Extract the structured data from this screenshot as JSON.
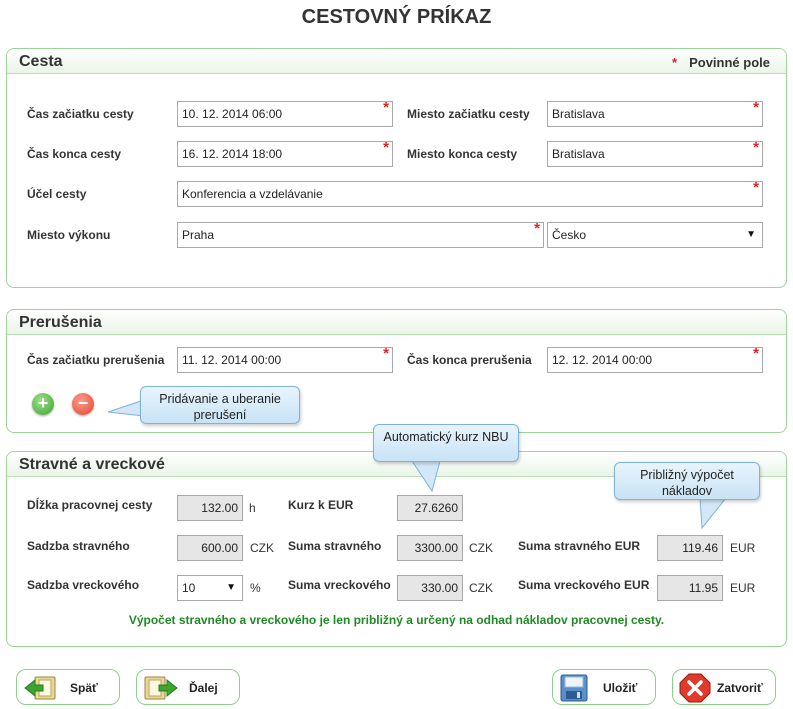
{
  "page": {
    "title": "CESTOVNÝ PRÍKAZ"
  },
  "trip": {
    "title": "Cesta",
    "required_note": "Povinné pole",
    "start_time_label": "Čas začiatku cesty",
    "start_time_value": "10. 12. 2014 06:00",
    "start_place_label": "Miesto začiatku cesty",
    "start_place_value": "Bratislava",
    "end_time_label": "Čas konca cesty",
    "end_time_value": "16. 12. 2014 18:00",
    "end_place_label": "Miesto konca cesty",
    "end_place_value": "Bratislava",
    "purpose_label": "Účel cesty",
    "purpose_value": "Konferencia a vzdelávanie",
    "work_place_label": "Miesto výkonu",
    "work_place_value": "Praha",
    "country_value": "Česko"
  },
  "interruptions": {
    "title": "Prerušenia",
    "start_label": "Čas začiatku prerušenia",
    "start_value": "11. 12. 2014 00:00",
    "end_label": "Čas konca prerušenia",
    "end_value": "12. 12. 2014 00:00",
    "callout": "Pridávanie a uberanie prerušení"
  },
  "allowances": {
    "title": "Stravné a vreckové",
    "length_label": "Dĺžka pracovnej cesty",
    "length_value": "132.00",
    "length_unit": "h",
    "rate_label": "Kurz k EUR",
    "rate_value": "27.6260",
    "meal_rate_label": "Sadzba stravného",
    "meal_rate_value": "600.00",
    "meal_rate_unit": "CZK",
    "meal_sum_label": "Suma stravného",
    "meal_sum_value": "3300.00",
    "meal_sum_unit": "CZK",
    "meal_eur_label": "Suma stravného EUR",
    "meal_eur_value": "119.46",
    "meal_eur_unit": "EUR",
    "pocket_rate_label": "Sadzba vreckového",
    "pocket_rate_value": "10",
    "pocket_rate_unit": "%",
    "pocket_sum_label": "Suma vreckového",
    "pocket_sum_value": "330.00",
    "pocket_sum_unit": "CZK",
    "pocket_eur_label": "Suma vreckového EUR",
    "pocket_eur_value": "11.95",
    "pocket_eur_unit": "EUR",
    "callout_rate": "Automatický kurz NBU",
    "callout_costs": "Približný výpočet nákladov",
    "note": "Výpočet stravného a vreckového je len približný a určený na odhad nákladov pracovnej cesty."
  },
  "actions": {
    "back": "Späť",
    "next": "Ďalej",
    "save": "Uložiť",
    "close": "Zatvoriť"
  },
  "colors": {
    "panel_border": "#9cd49a",
    "required": "#e02020",
    "note": "#1f8a24",
    "callout": "#c8e3f6"
  }
}
